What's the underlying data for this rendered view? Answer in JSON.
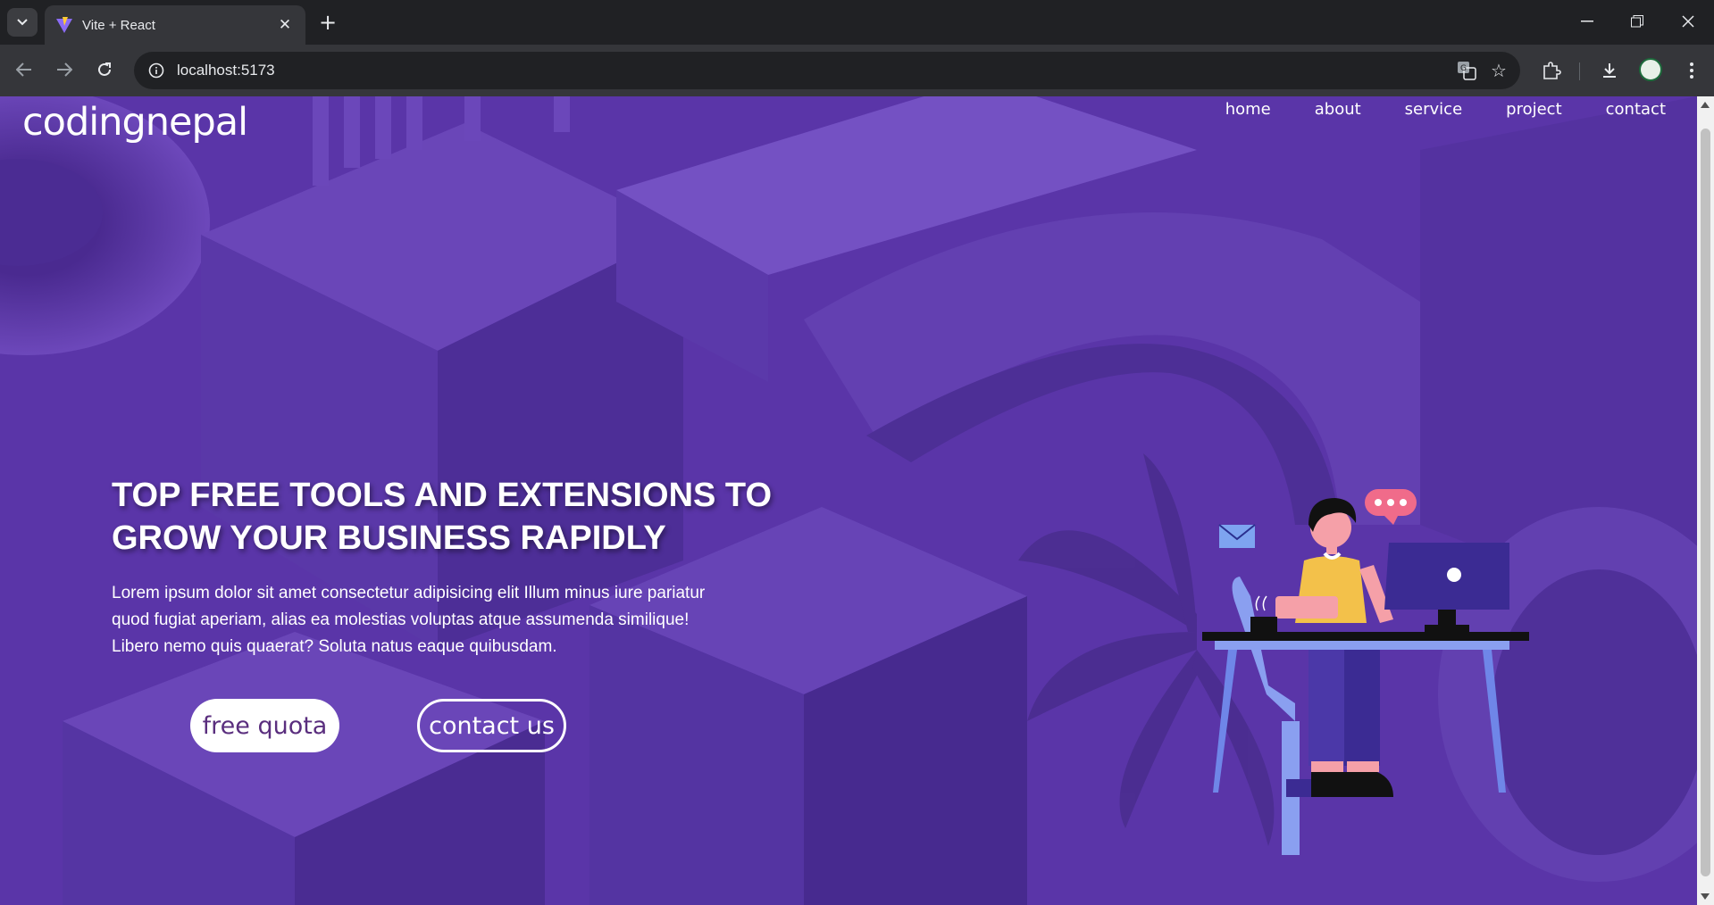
{
  "browser": {
    "tab_title": "Vite + React",
    "url": "localhost:5173",
    "icons": {
      "tab_menu": "chevron-down-icon",
      "tab_close": "close-icon",
      "new_tab": "plus-icon",
      "back": "arrow-left-icon",
      "forward": "arrow-right-icon",
      "reload": "reload-icon",
      "site_info": "info-icon",
      "translate": "translate-icon",
      "bookmark": "star-icon",
      "extensions": "puzzle-icon",
      "download": "download-icon",
      "menu": "more-vertical-icon"
    }
  },
  "site": {
    "logo": "codingnepal",
    "nav": [
      "home",
      "about",
      "service",
      "project",
      "contact"
    ],
    "hero": {
      "title_line1": "TOP FREE TOOLS AND EXTENSIONS TO",
      "title_line2": "GROW YOUR BUSINESS RAPIDLY",
      "text_line1": "Lorem ipsum dolor sit amet consectetur adipisicing elit Illum minus iure pariatur",
      "text_line2": "quod fugiat aperiam, alias ea molestias voluptas atque assumenda similique!",
      "text_line3": "Libero nemo quis quaerat? Soluta natus eaque quibusdam.",
      "btn_quota": "free quota",
      "btn_contact": "contact us"
    }
  },
  "colors": {
    "background": "#5a35a8",
    "button_text": "#5a2e7e",
    "chrome_dark": "#202124",
    "chrome_toolbar": "#35363a"
  }
}
